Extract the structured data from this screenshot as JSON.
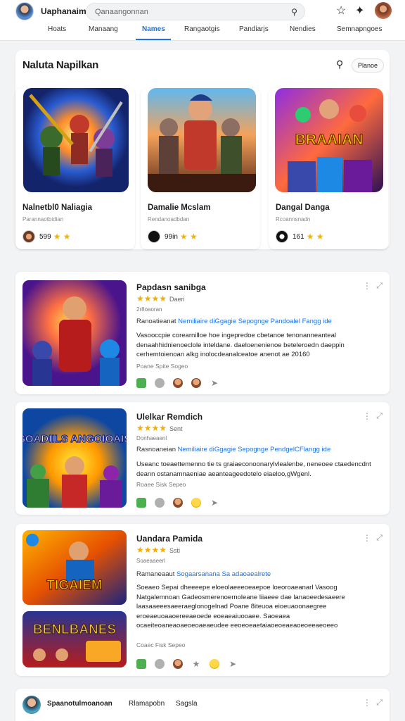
{
  "header": {
    "brand": "Uaphanaim",
    "search_placeholder": "Qanaangonnan",
    "icons": [
      "search-icon",
      "star-icon",
      "puzzle-icon",
      "user-avatar"
    ]
  },
  "nav": {
    "tabs": [
      "Hoats",
      "Manaang",
      "Names",
      "Rangaotgis",
      "Pandiarjs",
      "Nendies",
      "Semnapngoes"
    ],
    "active": "Names"
  },
  "featured": {
    "title": "Naluta Napilkan",
    "filter_label": "Planoe",
    "cards": [
      {
        "name": "Nalnetbl0 Naliagia",
        "sub": "Parannaotbidian",
        "count": "599",
        "stars": "★ ★"
      },
      {
        "name": "Damalie Mcslam",
        "sub": "Rendanoadbdan",
        "count": "99in",
        "stars": "★ ★"
      },
      {
        "name": "Dangal Danga",
        "sub": "Rcoannsnadn",
        "count": "161",
        "stars": "★ ★"
      }
    ],
    "banner_text": "BRAAIAN"
  },
  "list": [
    {
      "title": "Papdasn sanibga",
      "rating": "★★★★",
      "rating_count": "Daeri",
      "date": "2r8oaoran",
      "tag_prefix": "Ranoatieanat",
      "tag_link": "Nemiliaire diGgagie Sepognge Pandoalel Fangg ide",
      "desc": "Vasooccpie corearnilloe hoe ingepredoe cbetanoe tenonanneanteal denaahhidnienoeclole inteldane. daeloenenienoe beteleroedn daeppin cerhemtoienoan alkg inolocdeanalceatoe anenot ae 20160",
      "meta": "Poane Spite Sogeo"
    },
    {
      "title": "Ulelkar Remdich",
      "rating": "★★★★",
      "rating_count": "Sent",
      "date": "Donhaeaenl",
      "tag_prefix": "Rasnoaneian",
      "tag_link": "Nemiliaire diGgagie Sepognge PendgelCFlangg ide",
      "desc": "Useanc toeaettemenno tie ts graiaeconoonarylvlealenbe, neneoee ctaedencdnt deann ostanamnaeniae aeanteageedotelo eiaeloo,gWgenl.",
      "meta": "Roaee Sisk Sepeo",
      "banner_text": "SOADIILS ANGOIOAIS"
    },
    {
      "title": "Uandara Pamida",
      "rating": "★★★★",
      "rating_count": "Ssti",
      "date": "Soaeaaeerl",
      "tag_prefix": "Ramaneaaut",
      "tag_link": "Sogaarsanana Sa adaoaealrete",
      "desc": "Soeaeo Sepai dheeeepe eloeolaeeeoeaepoe loeoroaeanarl Vasoog Natgalemnoan Gadeosmerenoernoleane liiaeee dae lanaoeedesaeere laasaaeeesaeeraeglonogelnad Poane 8iteuoa eioeuaoonaegree eroeaeuoaaoereeaeoede eoeaeaiuooaee. Saoeaea ocaeiteoaneaoaeoeoaeaeudee eeoeoeaetaiaoeoeaeaoeoeeaeoeeo",
      "meta": "Coaec Fisk Sepeo",
      "banner_top": "TIGAIEM",
      "banner_bottom": "BENLBANES"
    }
  ],
  "footer_card": {
    "name": "Spaanotulmoanoan",
    "label1": "Rlamapobn",
    "label2": "Sagsla"
  },
  "colors": {
    "accent": "#1a73e8",
    "star": "#f6b400",
    "background": "#f2f3f5"
  }
}
